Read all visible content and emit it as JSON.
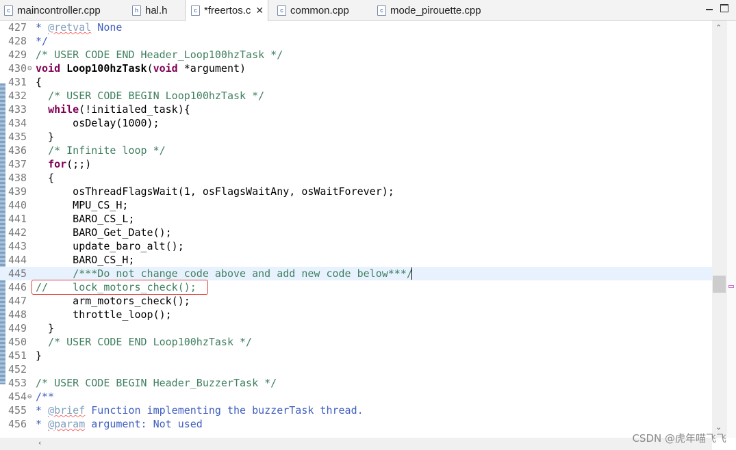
{
  "tabs": [
    {
      "label": "maincontroller.cpp",
      "icon": "c"
    },
    {
      "label": "hal.h",
      "icon": "h"
    },
    {
      "label": "*freertos.c",
      "icon": "c",
      "close": "✕"
    },
    {
      "label": "common.cpp",
      "icon": "c"
    },
    {
      "label": "mode_pirouette.cpp",
      "icon": "c"
    }
  ],
  "lines": [
    {
      "n": "427",
      "parts": [
        {
          "t": "* ",
          "c": "doc"
        },
        {
          "t": "@retval",
          "c": "tag"
        },
        {
          "t": " None",
          "c": "doc"
        }
      ]
    },
    {
      "n": "428",
      "parts": [
        {
          "t": "*/",
          "c": "doc"
        }
      ]
    },
    {
      "n": "429",
      "parts": [
        {
          "t": "/* USER CODE END Header_Loop100hzTask */",
          "c": "cm"
        }
      ]
    },
    {
      "n": "430",
      "fold": "⊖",
      "parts": [
        {
          "t": "void",
          "c": "kw"
        },
        {
          "t": " "
        },
        {
          "t": "Loop100hzTask",
          "c": "fn"
        },
        {
          "t": "("
        },
        {
          "t": "void",
          "c": "kw"
        },
        {
          "t": " *argument)"
        }
      ]
    },
    {
      "n": "431",
      "parts": [
        {
          "t": "{"
        }
      ]
    },
    {
      "n": "432",
      "parts": [
        {
          "t": "  "
        },
        {
          "t": "/* USER CODE BEGIN Loop100hzTask */",
          "c": "cm"
        }
      ]
    },
    {
      "n": "433",
      "parts": [
        {
          "t": "  "
        },
        {
          "t": "while",
          "c": "kw"
        },
        {
          "t": "(!initialed_task){"
        }
      ]
    },
    {
      "n": "434",
      "parts": [
        {
          "t": "      osDelay(1000);"
        }
      ]
    },
    {
      "n": "435",
      "parts": [
        {
          "t": "  }"
        }
      ]
    },
    {
      "n": "436",
      "parts": [
        {
          "t": "  "
        },
        {
          "t": "/* Infinite loop */",
          "c": "cm"
        }
      ]
    },
    {
      "n": "437",
      "parts": [
        {
          "t": "  "
        },
        {
          "t": "for",
          "c": "kw"
        },
        {
          "t": "(;;)"
        }
      ]
    },
    {
      "n": "438",
      "parts": [
        {
          "t": "  {"
        }
      ]
    },
    {
      "n": "439",
      "parts": [
        {
          "t": "      osThreadFlagsWait(1, osFlagsWaitAny, osWaitForever);"
        }
      ]
    },
    {
      "n": "440",
      "parts": [
        {
          "t": "      MPU_CS_H;"
        }
      ]
    },
    {
      "n": "441",
      "parts": [
        {
          "t": "      BARO_CS_L;"
        }
      ]
    },
    {
      "n": "442",
      "parts": [
        {
          "t": "      BARO_Get_Date();"
        }
      ]
    },
    {
      "n": "443",
      "parts": [
        {
          "t": "      update_baro_alt();"
        }
      ]
    },
    {
      "n": "444",
      "parts": [
        {
          "t": "      BARO_CS_H;"
        }
      ]
    },
    {
      "n": "445",
      "current": true,
      "parts": [
        {
          "t": "      "
        },
        {
          "t": "/***Do not change code above and add new code below***/",
          "c": "cm"
        }
      ]
    },
    {
      "n": "446",
      "parts": [
        {
          "t": "//    lock_motors_check();",
          "c": "cm"
        }
      ]
    },
    {
      "n": "447",
      "parts": [
        {
          "t": "      arm_motors_check();"
        }
      ]
    },
    {
      "n": "448",
      "parts": [
        {
          "t": "      throttle_loop();"
        }
      ]
    },
    {
      "n": "449",
      "parts": [
        {
          "t": "  }"
        }
      ]
    },
    {
      "n": "450",
      "parts": [
        {
          "t": "  "
        },
        {
          "t": "/* USER CODE END Loop100hzTask */",
          "c": "cm"
        }
      ]
    },
    {
      "n": "451",
      "parts": [
        {
          "t": "}"
        }
      ]
    },
    {
      "n": "452",
      "parts": [
        {
          "t": ""
        }
      ]
    },
    {
      "n": "453",
      "parts": [
        {
          "t": "/* USER CODE BEGIN Header_BuzzerTask */",
          "c": "cm"
        }
      ]
    },
    {
      "n": "454",
      "fold": "⊖",
      "parts": [
        {
          "t": "/**",
          "c": "doc"
        }
      ]
    },
    {
      "n": "455",
      "parts": [
        {
          "t": "* ",
          "c": "doc"
        },
        {
          "t": "@brief",
          "c": "tag"
        },
        {
          "t": " Function implementing the buzzerTask thread.",
          "c": "doc"
        }
      ]
    },
    {
      "n": "456",
      "parts": [
        {
          "t": "* ",
          "c": "doc"
        },
        {
          "t": "@param",
          "c": "tag"
        },
        {
          "t": " argument: Not used",
          "c": "doc"
        }
      ]
    }
  ],
  "watermark": "CSDN @虎年喵飞飞"
}
